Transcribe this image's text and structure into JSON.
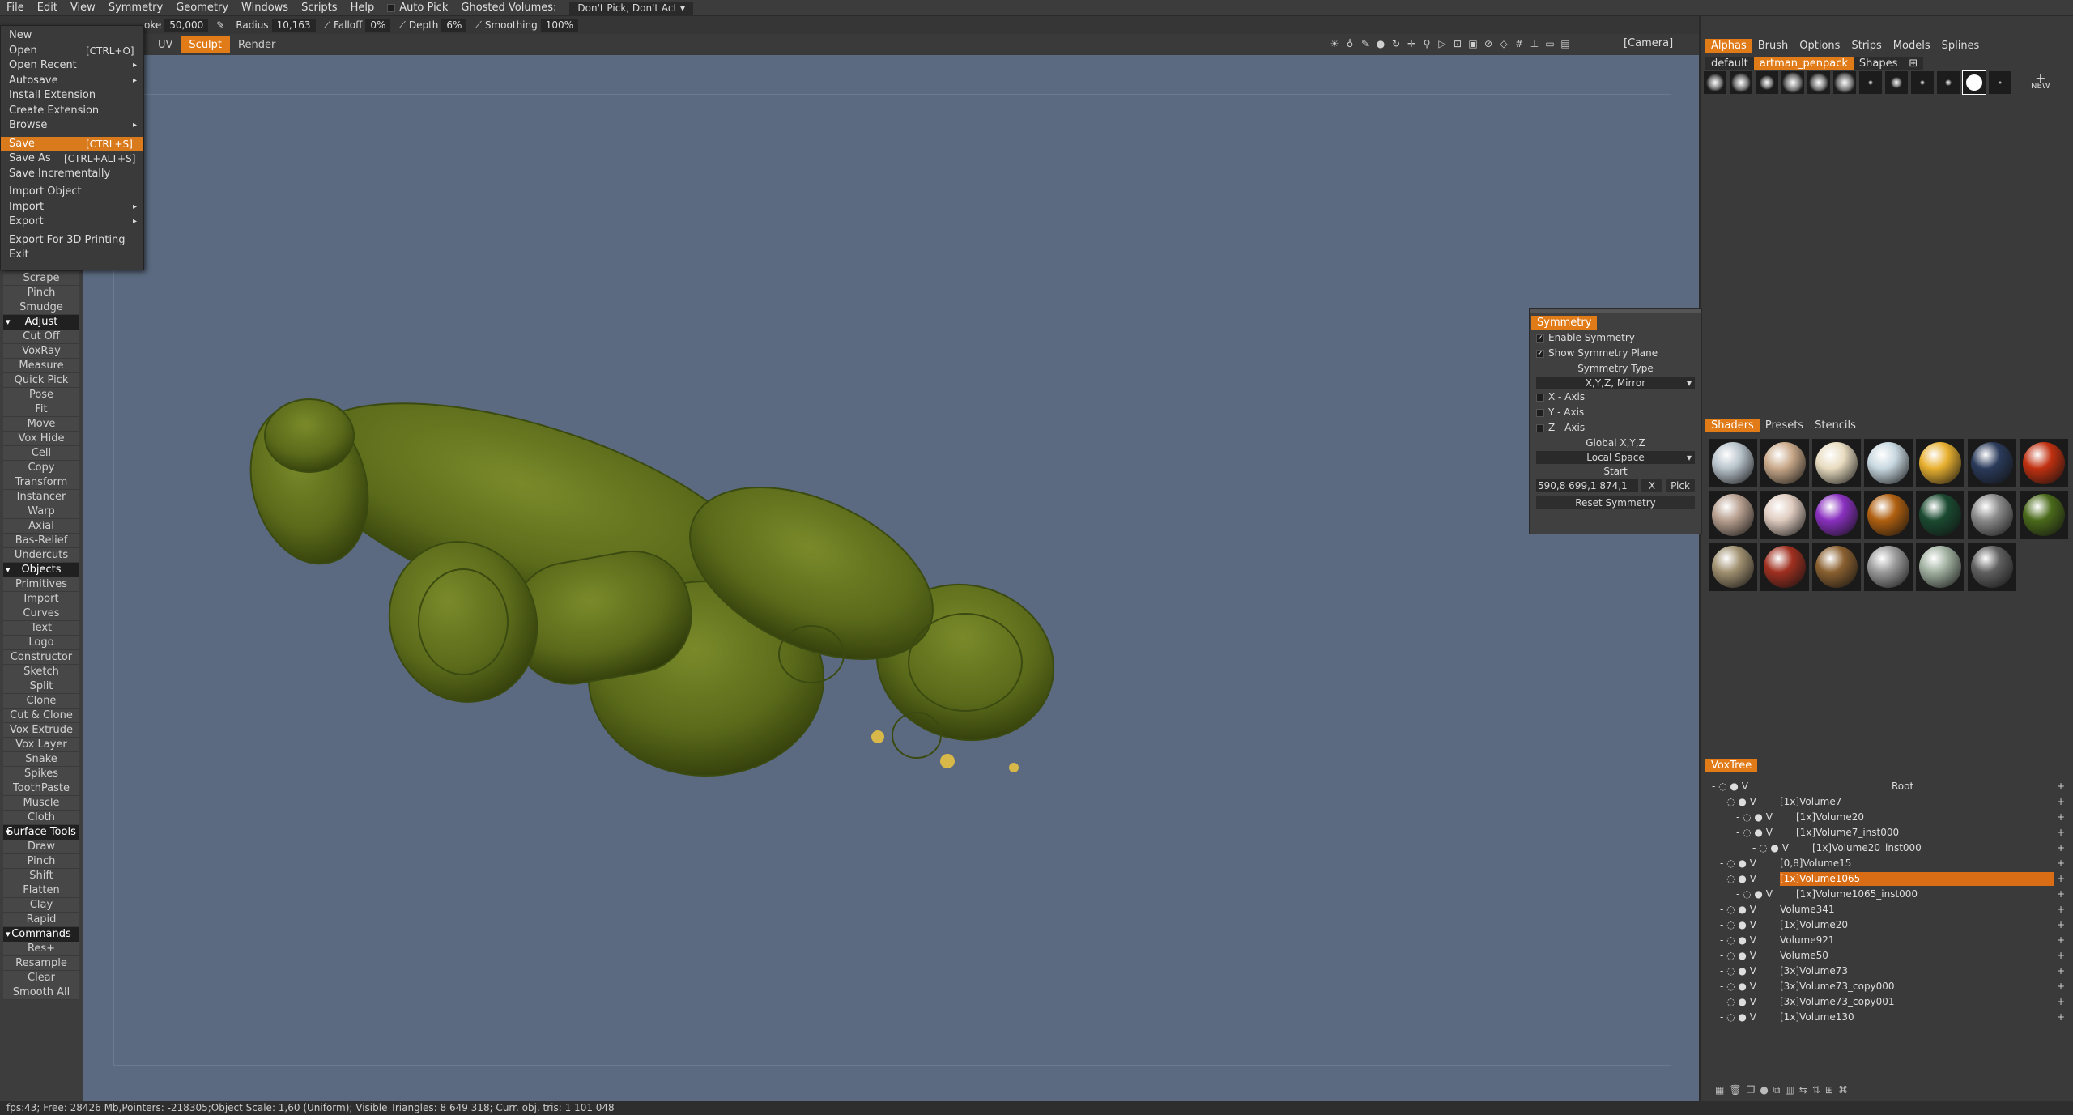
{
  "menubar": {
    "items": [
      "File",
      "Edit",
      "View",
      "Symmetry",
      "Geometry",
      "Windows",
      "Scripts",
      "Help"
    ],
    "auto_pick": "Auto Pick",
    "ghosted": "Ghosted Volumes:",
    "ghosted_value": "Don't Pick, Don't Act"
  },
  "toolbar": {
    "stroke_label": "oke",
    "stroke_value": "50,000",
    "radius_label": "Radius",
    "radius_value": "10,163",
    "falloff_label": "Falloff",
    "falloff_value": "0%",
    "depth_label": "Depth",
    "depth_value": "6%",
    "smoothing_label": "Smoothing",
    "smoothing_value": "100%"
  },
  "modes": {
    "uv": "UV",
    "sculpt": "Sculpt",
    "render": "Render"
  },
  "camera": "[Camera]",
  "file_menu": [
    {
      "label": "New",
      "shortcut": "",
      "arrow": ""
    },
    {
      "label": "Open",
      "shortcut": "[CTRL+O]",
      "arrow": ""
    },
    {
      "label": "Open Recent",
      "shortcut": "",
      "arrow": "▸"
    },
    {
      "label": "Autosave",
      "shortcut": "",
      "arrow": "▸"
    },
    {
      "label": "Install Extension",
      "shortcut": "",
      "arrow": ""
    },
    {
      "label": "Create Extension",
      "shortcut": "",
      "arrow": ""
    },
    {
      "label": "Browse",
      "shortcut": "",
      "arrow": "▸"
    },
    {
      "label": "Save",
      "shortcut": "[CTRL+S]",
      "arrow": ""
    },
    {
      "label": "Save As",
      "shortcut": "[CTRL+ALT+S]",
      "arrow": ""
    },
    {
      "label": "Save Incrementally",
      "shortcut": "",
      "arrow": ""
    },
    {
      "label": "Import Object",
      "shortcut": "",
      "arrow": ""
    },
    {
      "label": "Import",
      "shortcut": "",
      "arrow": "▸"
    },
    {
      "label": "Export",
      "shortcut": "",
      "arrow": "▸"
    },
    {
      "label": "Export For 3D Printing",
      "shortcut": "",
      "arrow": ""
    },
    {
      "label": "Exit",
      "shortcut": "",
      "arrow": ""
    }
  ],
  "left_tools": {
    "top": [
      "Scrape",
      "Pinch",
      "Smudge"
    ],
    "adjust": "Adjust",
    "adjust_items": [
      "Cut Off",
      "VoxRay",
      "Measure",
      "Quick Pick",
      "Pose",
      "Fit",
      "Move",
      "Vox Hide",
      "Cell",
      "Copy",
      "Transform",
      "Instancer",
      "Warp",
      "Axial",
      "Bas-Relief",
      "Undercuts"
    ],
    "objects": "Objects",
    "objects_items": [
      "Primitives",
      "Import",
      "Curves",
      "Text",
      "Logo",
      "Constructor",
      "Sketch",
      "Split",
      "Clone",
      "Cut & Clone",
      "Vox Extrude",
      "Vox Layer",
      "Snake",
      "Spikes",
      "ToothPaste",
      "Muscle",
      "Cloth"
    ],
    "surface": "Surface Tools",
    "surface_items": [
      "Draw",
      "Pinch",
      "Shift",
      "Flatten",
      "Clay",
      "Rapid"
    ],
    "commands": "Commands",
    "commands_items": [
      "Res+",
      "Resample",
      "Clear",
      "Smooth All"
    ]
  },
  "right_tabs": [
    "Alphas",
    "Brush",
    "Options",
    "Strips",
    "Models",
    "Splines"
  ],
  "alpha_sets": [
    "default",
    "artman_penpack",
    "Shapes"
  ],
  "alpha_new": "NEW",
  "shader_tabs": [
    "Shaders",
    "Presets",
    "Stencils"
  ],
  "shader_colors": [
    "#b9c4cc",
    "#c9a98a",
    "#e8dcc0",
    "#c8d8e0",
    "#e8b030",
    "#2a3a5a",
    "#c03010",
    "#b8a090",
    "#e0ccc0",
    "#8a30c0",
    "#b06010",
    "#1a4a30",
    "#8a8a8a",
    "#4a6a1a",
    "#a09070",
    "#a03020",
    "#8a6030",
    "#9a9a9a",
    "#a0b0a0",
    "#606060"
  ],
  "symmetry": {
    "title": "Symmetry",
    "enable": "Enable Symmetry",
    "show_plane": "Show Symmetry Plane",
    "type_label": "Symmetry Type",
    "type_value": "X,Y,Z, Mirror",
    "x_axis": "X - Axis",
    "y_axis": "Y - Axis",
    "z_axis": "Z - Axis",
    "global": "Global X,Y,Z",
    "space": "Local Space",
    "start": "Start",
    "start_value": "590,8 699,1 874,1",
    "x_btn": "X",
    "pick_btn": "Pick",
    "reset": "Reset Symmetry"
  },
  "voxtree": {
    "title": "VoxTree",
    "root": "Root",
    "items": [
      "[1x]Volume7",
      "[1x]Volume20",
      "[1x]Volume7_inst000",
      "[1x]Volume20_inst000",
      "[0,8]Volume15",
      "[1x]Volume1065",
      "[1x]Volume1065_inst000",
      "Volume341",
      "[1x]Volume20",
      "Volume921",
      "Volume50",
      "[3x]Volume73",
      "[3x]Volume73_copy000",
      "[3x]Volume73_copy001",
      "[1x]Volume130"
    ]
  },
  "status": "fps:43;    Free: 28426 Mb,Pointers: -218305;Object Scale: 1,60 (Uniform); Visible Triangles: 8 649 318; Curr. obj. tris: 1 101 048"
}
